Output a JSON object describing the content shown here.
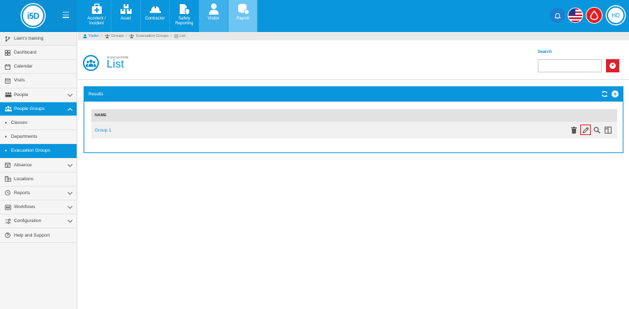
{
  "app": {
    "logo_text": "i5D",
    "avatar_initials": "HD"
  },
  "modules": [
    {
      "label": "Accident / Incident",
      "icon": "first-aid-icon",
      "state": "normal"
    },
    {
      "label": "Asset",
      "icon": "boxes-icon",
      "state": "normal"
    },
    {
      "label": "Contractor",
      "icon": "hardhat-icon",
      "state": "normal"
    },
    {
      "label": "Safety Reporting",
      "icon": "shield-document-icon",
      "state": "normal"
    },
    {
      "label": "Visitor",
      "icon": "person-icon",
      "state": "active"
    },
    {
      "label": "Payroll",
      "icon": "coins-icon",
      "state": "muted"
    }
  ],
  "sidebar": {
    "items": [
      {
        "label": "Liam's training",
        "icon": "branch-icon",
        "kind": "top",
        "chevron": false
      },
      {
        "label": "Dashboard",
        "icon": "dashboard-icon",
        "kind": "item",
        "chevron": false
      },
      {
        "label": "Calendar",
        "icon": "calendar-icon",
        "kind": "item",
        "chevron": false
      },
      {
        "label": "Visits",
        "icon": "visits-icon",
        "kind": "item",
        "chevron": false
      },
      {
        "label": "People",
        "icon": "people-icon",
        "kind": "item",
        "chevron": true
      },
      {
        "label": "People Groups",
        "icon": "group-icon",
        "kind": "active",
        "chevron": true
      },
      {
        "label": "Classes",
        "icon": "",
        "kind": "sub",
        "chevron": false
      },
      {
        "label": "Departments",
        "icon": "",
        "kind": "sub",
        "chevron": false
      },
      {
        "label": "Evacuation Groups",
        "icon": "",
        "kind": "sub-active",
        "chevron": false
      },
      {
        "label": "Absence",
        "icon": "absence-icon",
        "kind": "item",
        "chevron": true
      },
      {
        "label": "Locations",
        "icon": "building-icon",
        "kind": "item",
        "chevron": false
      },
      {
        "label": "Reports",
        "icon": "clock-icon",
        "kind": "item",
        "chevron": true
      },
      {
        "label": "Workflows",
        "icon": "workflow-icon",
        "kind": "item",
        "chevron": true
      },
      {
        "label": "Configuration",
        "icon": "configuration-icon",
        "kind": "item",
        "chevron": true
      },
      {
        "label": "Help and Support",
        "icon": "help-icon",
        "kind": "item",
        "chevron": false
      }
    ]
  },
  "breadcrumb": [
    "Visitor",
    "Groups",
    "Evacuation Groups",
    "List"
  ],
  "page": {
    "overline": "EVACUATION",
    "title": "List"
  },
  "search": {
    "label": "Search",
    "value": "",
    "placeholder": ""
  },
  "results": {
    "title": "Results",
    "columns": [
      "NAME"
    ],
    "rows": [
      {
        "name": "Group 1"
      }
    ]
  },
  "colors": {
    "primary": "#0a96dc",
    "danger": "#d9232d",
    "highlight": "#e0201f"
  }
}
